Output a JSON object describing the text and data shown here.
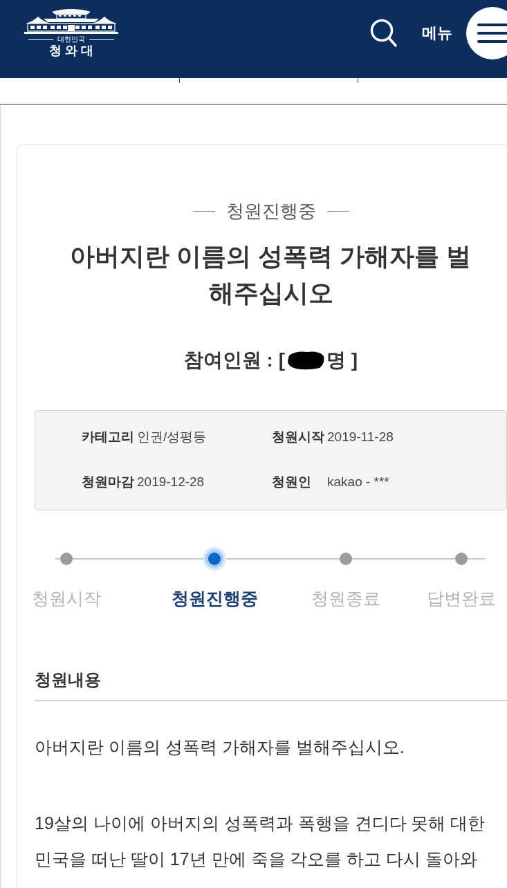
{
  "header": {
    "logo": {
      "subtitle": "대한민국",
      "name": "청 와 대"
    },
    "menu_label": "메뉴"
  },
  "petition": {
    "status": "청원진행중",
    "title": "아버지란 이름의 성폭력 가해자를 벌해주십시오",
    "participants": {
      "label": "참여인원 : [",
      "redacted": true,
      "unit": "명 ]"
    },
    "details": [
      {
        "label": "카테고리",
        "value": "인권/성평등"
      },
      {
        "label": "청원시작",
        "value": "2019-11-28"
      },
      {
        "label": "청원마감",
        "value": "2019-12-28"
      },
      {
        "label": "청원인",
        "value": "kakao - ***"
      }
    ],
    "steps": [
      {
        "label": "청원시작",
        "selected": false
      },
      {
        "label": "청원진행중",
        "selected": true
      },
      {
        "label": "청원종료",
        "selected": false
      },
      {
        "label": "답변완료",
        "selected": false
      }
    ],
    "content": {
      "heading": "청원내용",
      "paragraphs": [
        "아버지란 이름의 성폭력 가해자를 벌해주십시오.",
        "19살의 나이에 아버지의 성폭력과 폭행을 견디다 못해 대한민국을 떠난 딸이 17년 만에 죽을 각오를 하고 다시 돌아와"
      ]
    }
  }
}
